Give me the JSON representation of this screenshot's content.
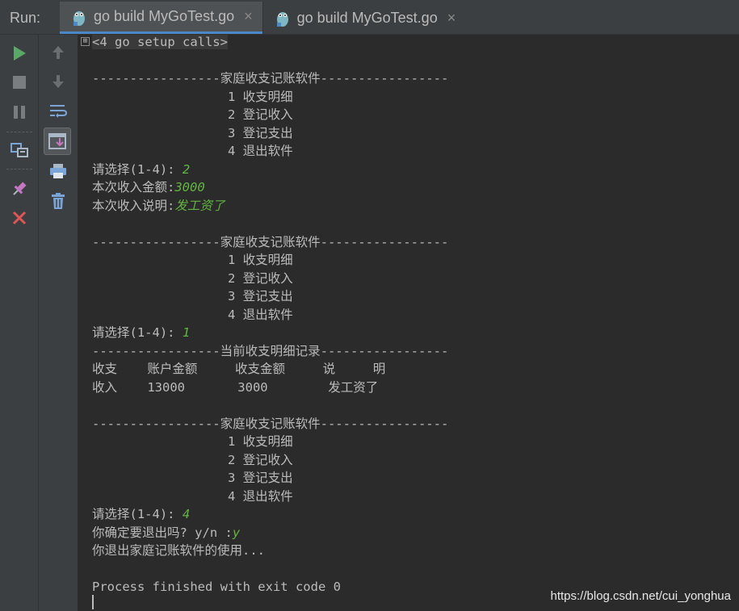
{
  "run_panel": {
    "label": "Run:",
    "tabs": [
      {
        "label": "go build MyGoTest.go",
        "close": "×",
        "active": true
      },
      {
        "label": "go build MyGoTest.go",
        "close": "×",
        "active": false
      }
    ]
  },
  "toolbar_left": [
    {
      "name": "rerun-icon",
      "color": "#59a869"
    },
    {
      "name": "stop-icon",
      "color": "#7a7d80"
    },
    {
      "name": "pause-icon",
      "color": "#7a7d80"
    },
    {
      "name": "dump-threads-icon",
      "color": "#7aa5d6"
    },
    {
      "name": "pin-tab-icon",
      "color": "#c478c4"
    },
    {
      "name": "close-icon",
      "color": "#e05555"
    }
  ],
  "toolbar_right": [
    {
      "name": "up-arrow-icon"
    },
    {
      "name": "down-arrow-icon"
    },
    {
      "name": "soft-wrap-icon"
    },
    {
      "name": "scroll-to-end-icon"
    },
    {
      "name": "print-icon"
    },
    {
      "name": "clear-all-icon"
    }
  ],
  "console": {
    "fold_marker": "⊞",
    "lines": [
      {
        "text": "<4 go setup calls>",
        "fold": true
      },
      {
        "text": ""
      },
      {
        "text": "-----------------家庭收支记账软件-----------------"
      },
      {
        "text": "                  1 收支明细"
      },
      {
        "text": "                  2 登记收入"
      },
      {
        "text": "                  3 登记支出"
      },
      {
        "text": "                  4 退出软件"
      },
      {
        "text": "请选择(1-4): ",
        "input": "2"
      },
      {
        "text": "本次收入金额:",
        "input": "3000"
      },
      {
        "text": "本次收入说明:",
        "input": "发工资了"
      },
      {
        "text": ""
      },
      {
        "text": "-----------------家庭收支记账软件-----------------"
      },
      {
        "text": "                  1 收支明细"
      },
      {
        "text": "                  2 登记收入"
      },
      {
        "text": "                  3 登记支出"
      },
      {
        "text": "                  4 退出软件"
      },
      {
        "text": "请选择(1-4): ",
        "input": "1"
      },
      {
        "text": "-----------------当前收支明细记录-----------------"
      },
      {
        "text": "收支    账户金额     收支金额     说     明"
      },
      {
        "text": "收入    13000       3000        发工资了"
      },
      {
        "text": ""
      },
      {
        "text": "-----------------家庭收支记账软件-----------------"
      },
      {
        "text": "                  1 收支明细"
      },
      {
        "text": "                  2 登记收入"
      },
      {
        "text": "                  3 登记支出"
      },
      {
        "text": "                  4 退出软件"
      },
      {
        "text": "请选择(1-4): ",
        "input": "4"
      },
      {
        "text": "你确定要退出吗? y/n :",
        "input": "y"
      },
      {
        "text": "你退出家庭记账软件的使用..."
      },
      {
        "text": ""
      },
      {
        "text": "Process finished with exit code 0"
      }
    ]
  },
  "watermark": "https://blog.csdn.net/cui_yonghua"
}
